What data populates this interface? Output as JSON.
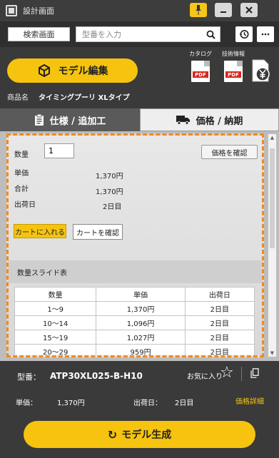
{
  "window": {
    "title": "設計画面"
  },
  "search": {
    "screen_button": "検索画面",
    "placeholder": "型番を入力"
  },
  "header": {
    "model_edit_label": "モデル編集",
    "catalog_label": "カタログ",
    "tech_info_label": "技術情報",
    "pdf_badge": "PDF",
    "product_name_label": "商品名",
    "product_name": "タイミングプーリ XLタイプ"
  },
  "tabs": {
    "spec_label": "仕様 / 追加工",
    "price_label": "価格 / 納期"
  },
  "price_panel": {
    "quantity_label": "数量",
    "quantity_value": "1",
    "confirm_price_button": "価格を確認",
    "unit_price_label": "単価",
    "unit_price_value": "1,370円",
    "total_label": "合計",
    "total_value": "1,370円",
    "ship_date_label": "出荷日",
    "ship_date_value": "2日目",
    "cart_add_button": "カートに入れる",
    "cart_check_button": "カートを確認"
  },
  "slide_table": {
    "title": "数量スライド表",
    "headers": [
      "数量",
      "単価",
      "出荷日"
    ],
    "rows": [
      [
        "1〜9",
        "1,370円",
        "2日目"
      ],
      [
        "10〜14",
        "1,096円",
        "2日目"
      ],
      [
        "15〜19",
        "1,027円",
        "2日目"
      ],
      [
        "20〜29",
        "959円",
        "2日目"
      ]
    ]
  },
  "info": {
    "model_label": "型番：",
    "model_number": "ATP30XL025-B-H10",
    "favorite_label": "お気に入り",
    "unit_price_label": "単価：",
    "unit_price_value": "1,370円",
    "ship_date_label": "出荷日：",
    "ship_date_value": "2日目",
    "price_detail_link": "価格詳細"
  },
  "generate": {
    "label": "モデル生成"
  },
  "colors": {
    "accent": "#f6c40f",
    "dash": "#f08a1f",
    "dark": "#3a3a3a"
  }
}
